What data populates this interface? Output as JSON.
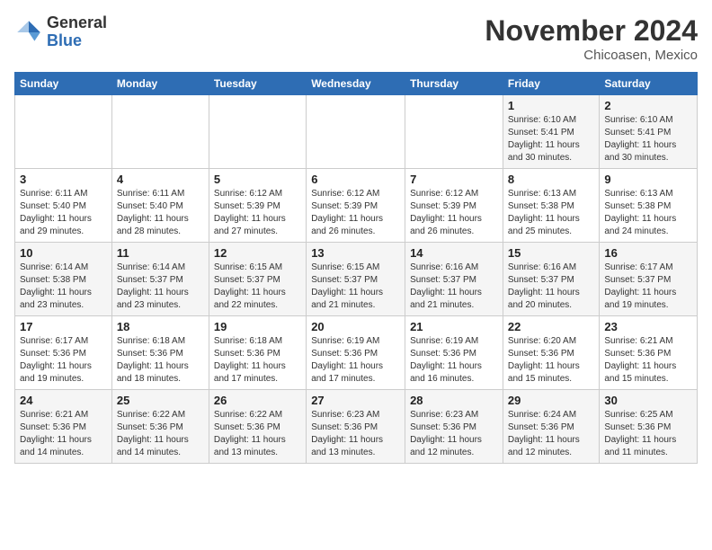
{
  "header": {
    "logo_general": "General",
    "logo_blue": "Blue",
    "month_title": "November 2024",
    "location": "Chicoasen, Mexico"
  },
  "weekdays": [
    "Sunday",
    "Monday",
    "Tuesday",
    "Wednesday",
    "Thursday",
    "Friday",
    "Saturday"
  ],
  "weeks": [
    [
      {
        "empty": true
      },
      {
        "empty": true
      },
      {
        "empty": true
      },
      {
        "empty": true
      },
      {
        "empty": true
      },
      {
        "day": 1,
        "sunrise": "6:10 AM",
        "sunset": "5:41 PM",
        "daylight": "11 hours and 30 minutes."
      },
      {
        "day": 2,
        "sunrise": "6:10 AM",
        "sunset": "5:41 PM",
        "daylight": "11 hours and 30 minutes."
      }
    ],
    [
      {
        "day": 3,
        "sunrise": "6:11 AM",
        "sunset": "5:40 PM",
        "daylight": "11 hours and 29 minutes."
      },
      {
        "day": 4,
        "sunrise": "6:11 AM",
        "sunset": "5:40 PM",
        "daylight": "11 hours and 28 minutes."
      },
      {
        "day": 5,
        "sunrise": "6:12 AM",
        "sunset": "5:39 PM",
        "daylight": "11 hours and 27 minutes."
      },
      {
        "day": 6,
        "sunrise": "6:12 AM",
        "sunset": "5:39 PM",
        "daylight": "11 hours and 26 minutes."
      },
      {
        "day": 7,
        "sunrise": "6:12 AM",
        "sunset": "5:39 PM",
        "daylight": "11 hours and 26 minutes."
      },
      {
        "day": 8,
        "sunrise": "6:13 AM",
        "sunset": "5:38 PM",
        "daylight": "11 hours and 25 minutes."
      },
      {
        "day": 9,
        "sunrise": "6:13 AM",
        "sunset": "5:38 PM",
        "daylight": "11 hours and 24 minutes."
      }
    ],
    [
      {
        "day": 10,
        "sunrise": "6:14 AM",
        "sunset": "5:38 PM",
        "daylight": "11 hours and 23 minutes."
      },
      {
        "day": 11,
        "sunrise": "6:14 AM",
        "sunset": "5:37 PM",
        "daylight": "11 hours and 23 minutes."
      },
      {
        "day": 12,
        "sunrise": "6:15 AM",
        "sunset": "5:37 PM",
        "daylight": "11 hours and 22 minutes."
      },
      {
        "day": 13,
        "sunrise": "6:15 AM",
        "sunset": "5:37 PM",
        "daylight": "11 hours and 21 minutes."
      },
      {
        "day": 14,
        "sunrise": "6:16 AM",
        "sunset": "5:37 PM",
        "daylight": "11 hours and 21 minutes."
      },
      {
        "day": 15,
        "sunrise": "6:16 AM",
        "sunset": "5:37 PM",
        "daylight": "11 hours and 20 minutes."
      },
      {
        "day": 16,
        "sunrise": "6:17 AM",
        "sunset": "5:37 PM",
        "daylight": "11 hours and 19 minutes."
      }
    ],
    [
      {
        "day": 17,
        "sunrise": "6:17 AM",
        "sunset": "5:36 PM",
        "daylight": "11 hours and 19 minutes."
      },
      {
        "day": 18,
        "sunrise": "6:18 AM",
        "sunset": "5:36 PM",
        "daylight": "11 hours and 18 minutes."
      },
      {
        "day": 19,
        "sunrise": "6:18 AM",
        "sunset": "5:36 PM",
        "daylight": "11 hours and 17 minutes."
      },
      {
        "day": 20,
        "sunrise": "6:19 AM",
        "sunset": "5:36 PM",
        "daylight": "11 hours and 17 minutes."
      },
      {
        "day": 21,
        "sunrise": "6:19 AM",
        "sunset": "5:36 PM",
        "daylight": "11 hours and 16 minutes."
      },
      {
        "day": 22,
        "sunrise": "6:20 AM",
        "sunset": "5:36 PM",
        "daylight": "11 hours and 15 minutes."
      },
      {
        "day": 23,
        "sunrise": "6:21 AM",
        "sunset": "5:36 PM",
        "daylight": "11 hours and 15 minutes."
      }
    ],
    [
      {
        "day": 24,
        "sunrise": "6:21 AM",
        "sunset": "5:36 PM",
        "daylight": "11 hours and 14 minutes."
      },
      {
        "day": 25,
        "sunrise": "6:22 AM",
        "sunset": "5:36 PM",
        "daylight": "11 hours and 14 minutes."
      },
      {
        "day": 26,
        "sunrise": "6:22 AM",
        "sunset": "5:36 PM",
        "daylight": "11 hours and 13 minutes."
      },
      {
        "day": 27,
        "sunrise": "6:23 AM",
        "sunset": "5:36 PM",
        "daylight": "11 hours and 13 minutes."
      },
      {
        "day": 28,
        "sunrise": "6:23 AM",
        "sunset": "5:36 PM",
        "daylight": "11 hours and 12 minutes."
      },
      {
        "day": 29,
        "sunrise": "6:24 AM",
        "sunset": "5:36 PM",
        "daylight": "11 hours and 12 minutes."
      },
      {
        "day": 30,
        "sunrise": "6:25 AM",
        "sunset": "5:36 PM",
        "daylight": "11 hours and 11 minutes."
      }
    ]
  ],
  "labels": {
    "sunrise": "Sunrise:",
    "sunset": "Sunset:",
    "daylight": "Daylight:"
  }
}
